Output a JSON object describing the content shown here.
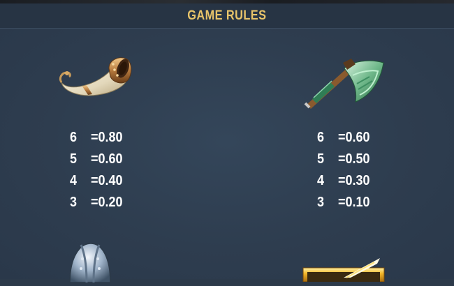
{
  "header": {
    "title": "GAME RULES"
  },
  "symbols": [
    {
      "name": "horn",
      "icon": "drinking-horn-icon",
      "payouts": [
        {
          "count": "6",
          "value": "=0.80"
        },
        {
          "count": "5",
          "value": "=0.60"
        },
        {
          "count": "4",
          "value": "=0.40"
        },
        {
          "count": "3",
          "value": "=0.20"
        }
      ]
    },
    {
      "name": "axe",
      "icon": "viking-axe-icon",
      "payouts": [
        {
          "count": "6",
          "value": "=0.60"
        },
        {
          "count": "5",
          "value": "=0.50"
        },
        {
          "count": "4",
          "value": "=0.30"
        },
        {
          "count": "3",
          "value": "=0.10"
        }
      ]
    },
    {
      "name": "helmet",
      "icon": "viking-helmet-icon"
    },
    {
      "name": "gold",
      "icon": "gold-frame-icon"
    }
  ],
  "colors": {
    "background": "#2c3a4a",
    "header_text": "#e8c46a",
    "payout_text": "#ffffff"
  }
}
